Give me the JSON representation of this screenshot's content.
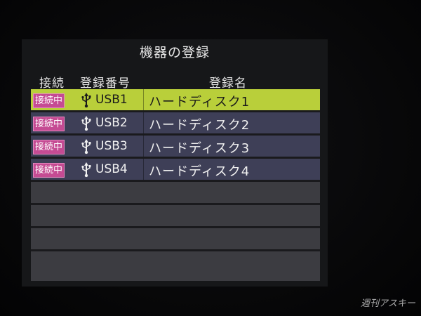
{
  "dialog": {
    "title": "機器の登録"
  },
  "columns": {
    "status": "接続",
    "number": "登録番号",
    "name": "登録名"
  },
  "devices": [
    {
      "status": "接続中",
      "number": "USB1",
      "name": "ハードディスク1",
      "selected": true
    },
    {
      "status": "接続中",
      "number": "USB2",
      "name": "ハードディスク2",
      "selected": false
    },
    {
      "status": "接続中",
      "number": "USB3",
      "name": "ハードディスク3",
      "selected": false
    },
    {
      "status": "接続中",
      "number": "USB4",
      "name": "ハードディスク4",
      "selected": false
    }
  ],
  "empty_rows": 4,
  "icons": {
    "usb": "usb-icon"
  },
  "colors": {
    "selected_row": "#b9cf3a",
    "device_row": "#3e3f57",
    "empty_row": "#3c3c41",
    "status_badge": "#c54b93"
  },
  "watermark": "週刊アスキー"
}
